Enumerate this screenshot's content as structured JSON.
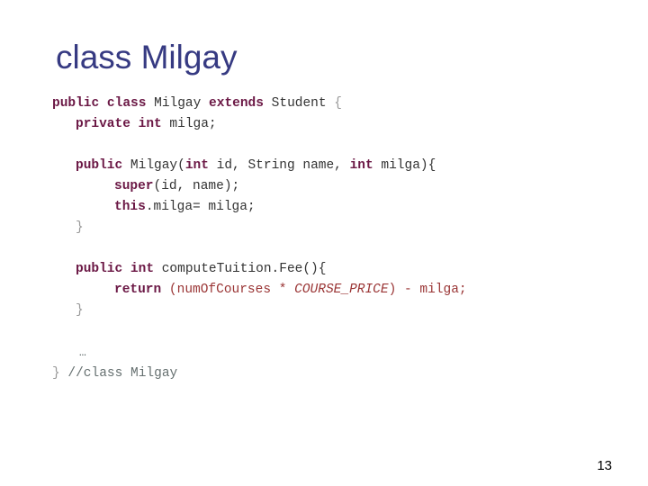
{
  "slide": {
    "title": "class Milgay",
    "page_number": "13",
    "colors": {
      "title": "#363a82",
      "keyword": "#6b1845",
      "identifier": "#333333",
      "brace": "#9a9a9a",
      "expression": "#9a3535",
      "comment": "#667070",
      "background": "#ffffff"
    }
  },
  "code": {
    "lines": [
      {
        "id": "line-class-decl",
        "indent": 0,
        "tokens": [
          {
            "t": "public class ",
            "k": "kw"
          },
          {
            "t": "Milgay ",
            "k": "id"
          },
          {
            "t": "extends ",
            "k": "kw"
          },
          {
            "t": "Student ",
            "k": "id"
          },
          {
            "t": "{",
            "k": "brace"
          }
        ]
      },
      {
        "id": "line-field-milga",
        "indent": 1,
        "tokens": [
          {
            "t": "private int ",
            "k": "kw"
          },
          {
            "t": "milga;",
            "k": "id"
          }
        ]
      },
      {
        "id": "line-blank-1",
        "indent": 0,
        "blank": true,
        "tokens": []
      },
      {
        "id": "line-constructor-signature",
        "indent": 1,
        "tokens": [
          {
            "t": "public ",
            "k": "kw"
          },
          {
            "t": "Milgay(",
            "k": "id"
          },
          {
            "t": "int ",
            "k": "kw"
          },
          {
            "t": "id, String name, ",
            "k": "id"
          },
          {
            "t": "int ",
            "k": "kw"
          },
          {
            "t": "milga){",
            "k": "id"
          }
        ]
      },
      {
        "id": "line-super-call",
        "indent": 2,
        "tokens": [
          {
            "t": "super",
            "k": "kw"
          },
          {
            "t": "(id, name);",
            "k": "id"
          }
        ]
      },
      {
        "id": "line-this-assign",
        "indent": 2,
        "tokens": [
          {
            "t": "this",
            "k": "kw"
          },
          {
            "t": ".milga= milga;",
            "k": "id"
          }
        ]
      },
      {
        "id": "line-close-constructor",
        "indent": 1,
        "tokens": [
          {
            "t": "}",
            "k": "brace"
          }
        ]
      },
      {
        "id": "line-blank-2",
        "indent": 0,
        "blank": true,
        "tokens": []
      },
      {
        "id": "line-method-signature",
        "indent": 1,
        "tokens": [
          {
            "t": "public int ",
            "k": "kw"
          },
          {
            "t": "computeTuition.Fee(){",
            "k": "id"
          }
        ]
      },
      {
        "id": "line-return-statement",
        "indent": 2,
        "tokens": [
          {
            "t": "return ",
            "k": "kw"
          },
          {
            "t": "(numOfCourses * ",
            "k": "expr"
          },
          {
            "t": "COURSE_PRICE",
            "k": "expr-it"
          },
          {
            "t": ") - milga;",
            "k": "expr"
          }
        ]
      },
      {
        "id": "line-close-method",
        "indent": 1,
        "tokens": [
          {
            "t": "}",
            "k": "brace"
          }
        ]
      },
      {
        "id": "line-blank-3",
        "indent": 0,
        "blank": true,
        "tokens": []
      },
      {
        "id": "line-ellipsis",
        "indent": 0,
        "dots": true,
        "tokens": [
          {
            "t": "…",
            "k": "dots"
          }
        ]
      },
      {
        "id": "line-close-class",
        "indent": 0,
        "tokens": [
          {
            "t": "} ",
            "k": "brace"
          },
          {
            "t": "//class Milgay",
            "k": "cmt"
          }
        ]
      }
    ]
  }
}
